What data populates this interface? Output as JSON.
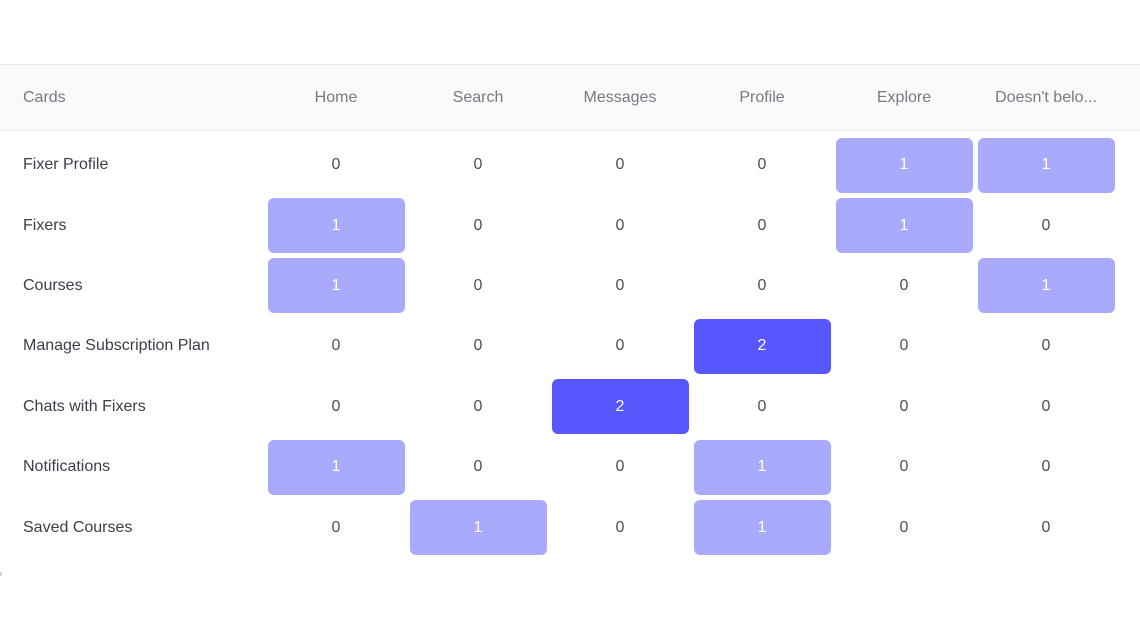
{
  "matrix": {
    "header": {
      "cards_label": "Cards",
      "columns": [
        "Home",
        "Search",
        "Messages",
        "Profile",
        "Explore",
        "Doesn't belo..."
      ]
    },
    "rows": [
      {
        "label": "Fixer Profile",
        "values": [
          0,
          0,
          0,
          0,
          1,
          1
        ]
      },
      {
        "label": "Fixers",
        "values": [
          1,
          0,
          0,
          0,
          1,
          0
        ]
      },
      {
        "label": "Courses",
        "values": [
          1,
          0,
          0,
          0,
          0,
          1
        ]
      },
      {
        "label": "Manage Subscription Plan",
        "values": [
          0,
          0,
          0,
          2,
          0,
          0
        ]
      },
      {
        "label": "Chats with Fixers",
        "values": [
          0,
          0,
          2,
          0,
          0,
          0
        ]
      },
      {
        "label": "Notifications",
        "values": [
          1,
          0,
          0,
          1,
          0,
          0
        ]
      },
      {
        "label": "Saved Courses",
        "values": [
          0,
          1,
          0,
          1,
          0,
          0
        ]
      }
    ]
  },
  "colors": {
    "level_1": "#aaaafd",
    "level_2": "#5757fd",
    "header_bg": "#fafafa"
  }
}
